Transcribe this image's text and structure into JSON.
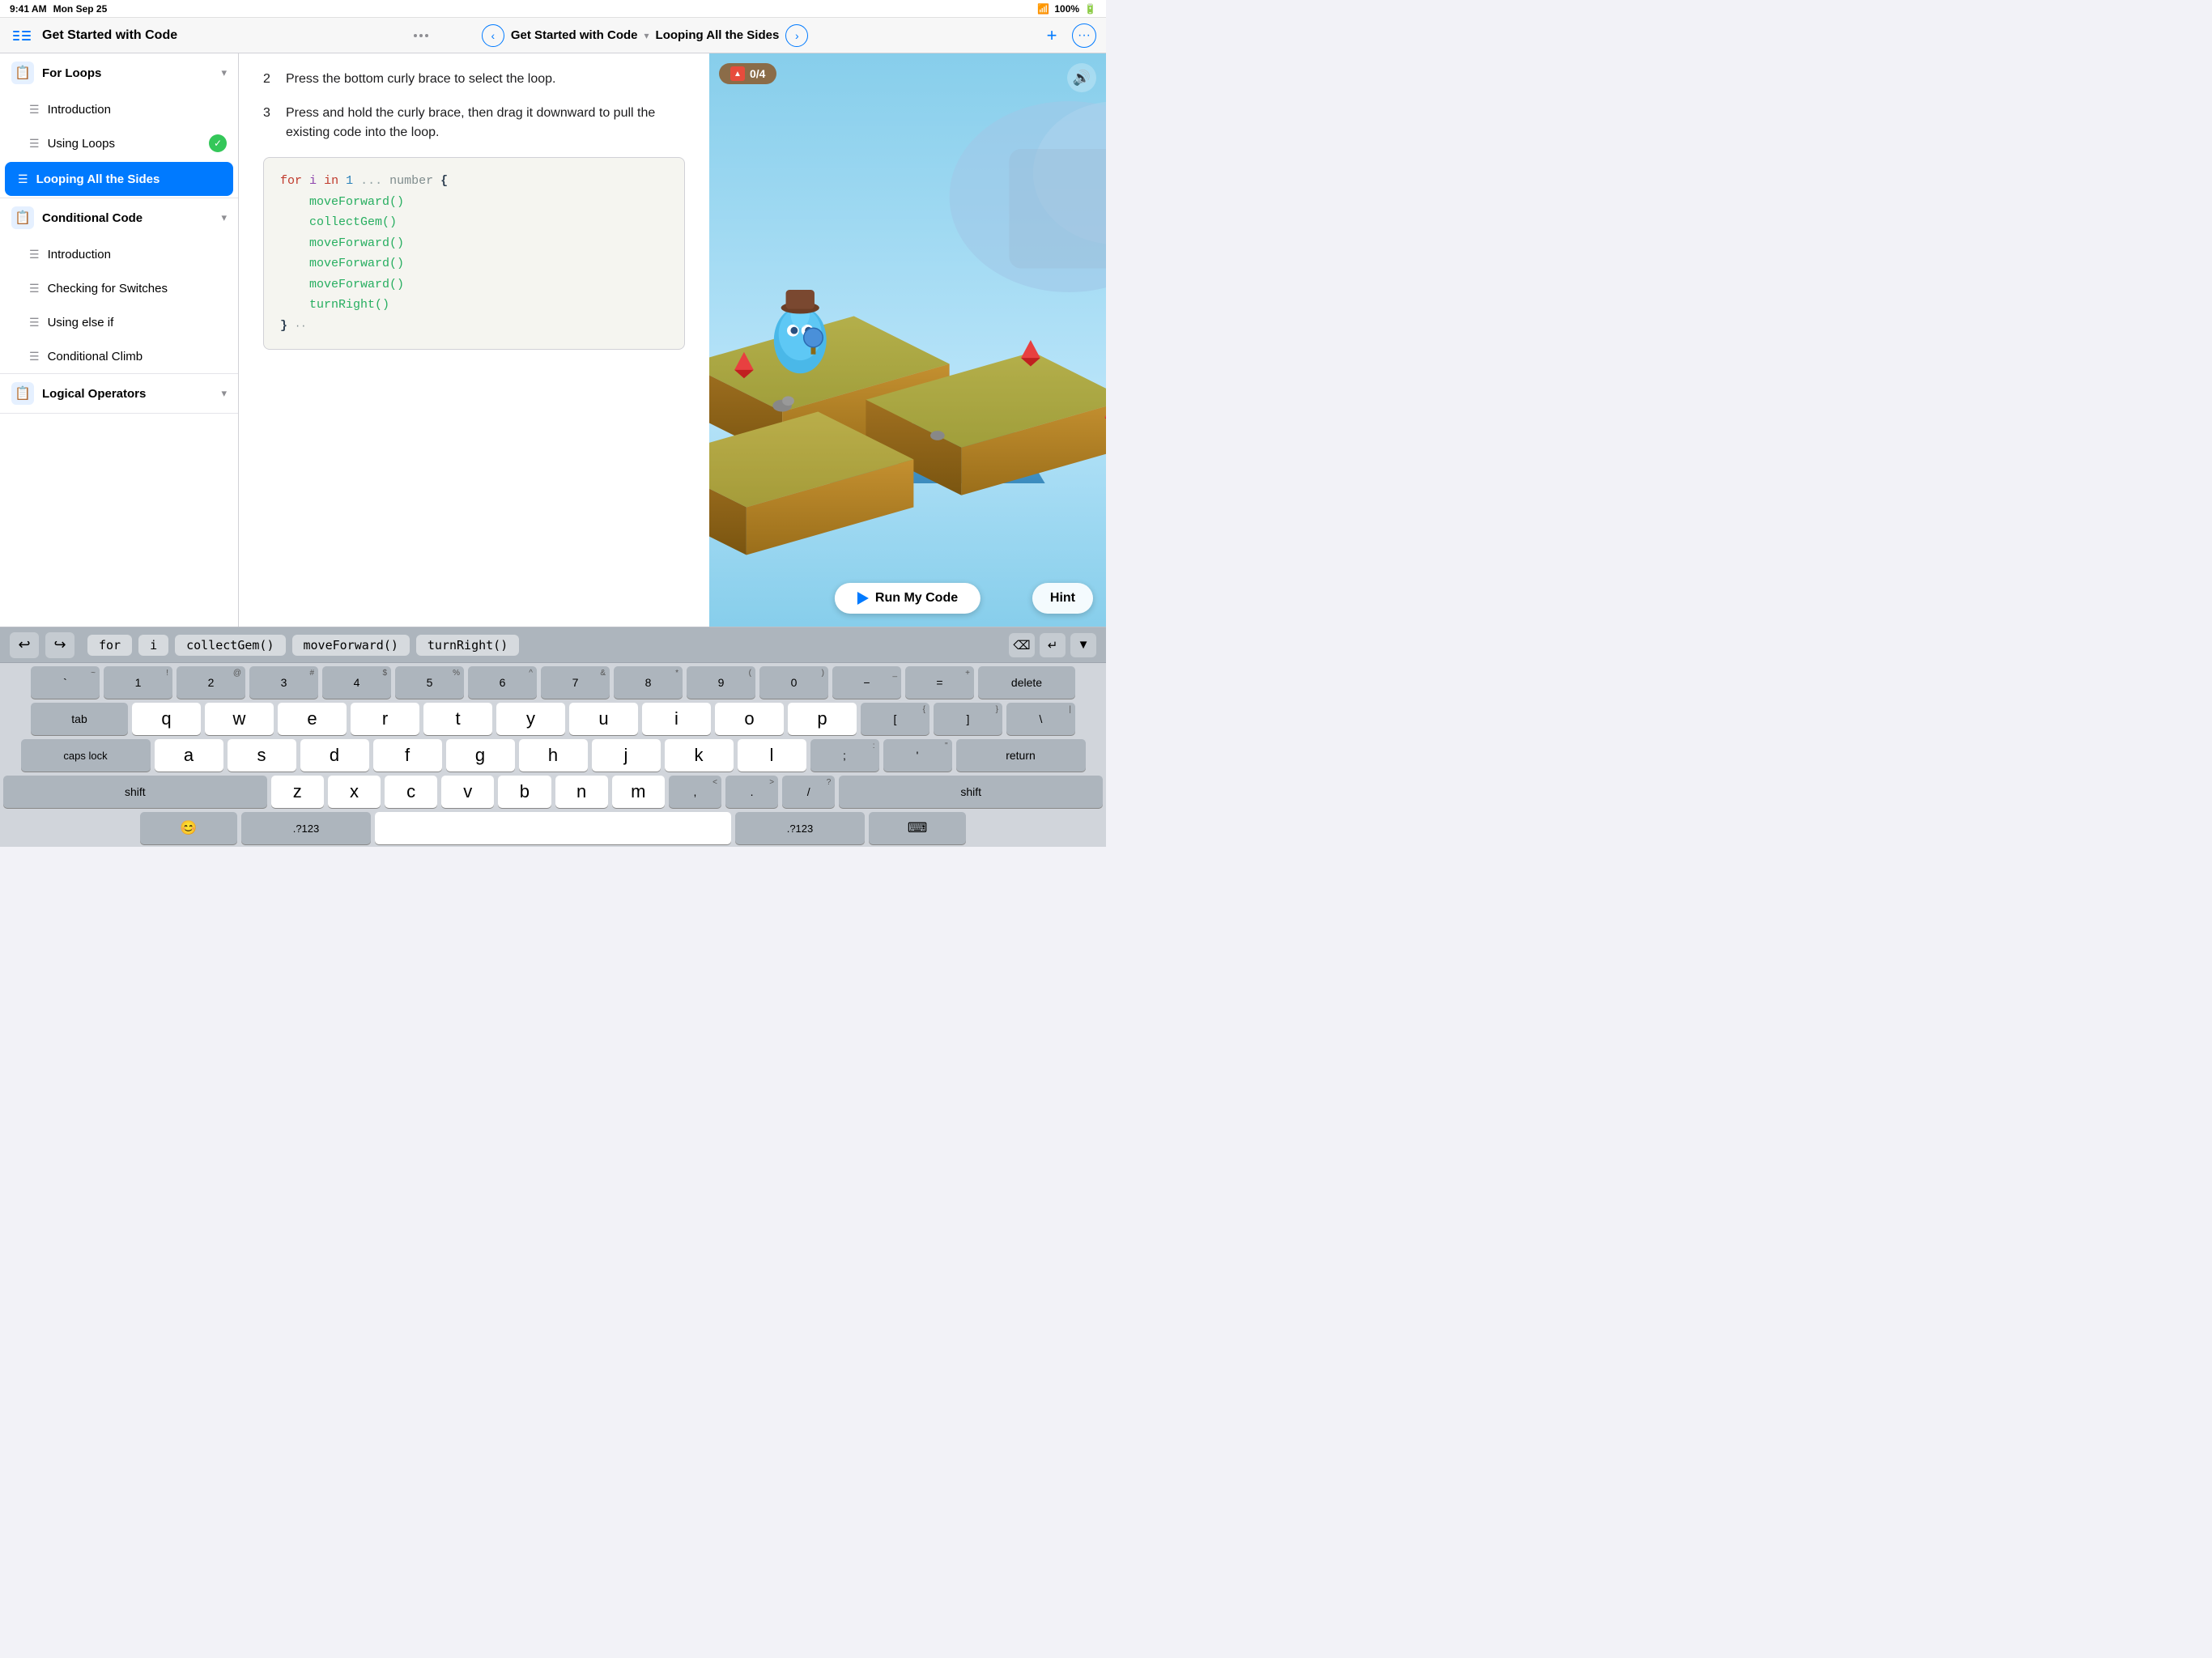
{
  "statusBar": {
    "time": "9:41 AM",
    "date": "Mon Sep 25",
    "wifi": "WiFi",
    "battery": "100%"
  },
  "navBar": {
    "appTitle": "Get Started with Code",
    "breadcrumbTitle": "Get Started with Code",
    "chevron": "▾",
    "lessonTitle": "Looping All the Sides",
    "addBtn": "+",
    "moreBtn": "···"
  },
  "sidebar": {
    "sections": [
      {
        "id": "for-loops",
        "icon": "📋",
        "title": "For Loops",
        "expanded": true,
        "items": [
          {
            "id": "intro-fl",
            "label": "Introduction",
            "active": false,
            "check": false
          },
          {
            "id": "using-loops",
            "label": "Using Loops",
            "active": false,
            "check": true
          },
          {
            "id": "looping-all",
            "label": "Looping All the Sides",
            "active": true,
            "check": false
          }
        ]
      },
      {
        "id": "conditional-code",
        "icon": "📋",
        "title": "Conditional Code",
        "expanded": true,
        "items": [
          {
            "id": "intro-cc",
            "label": "Introduction",
            "active": false,
            "check": false
          },
          {
            "id": "checking-switches",
            "label": "Checking for Switches",
            "active": false,
            "check": false
          },
          {
            "id": "using-else-if",
            "label": "Using else if",
            "active": false,
            "check": false
          },
          {
            "id": "conditional-climb",
            "label": "Conditional Climb",
            "active": false,
            "check": false
          }
        ]
      },
      {
        "id": "logical-operators",
        "icon": "📋",
        "title": "Logical Operators",
        "expanded": false,
        "items": []
      }
    ]
  },
  "content": {
    "steps": [
      {
        "number": "2",
        "text": "Press the bottom curly brace to select the loop."
      },
      {
        "number": "3",
        "text": "Press and hold the curly brace, then drag it downward to pull the existing code into the loop."
      }
    ],
    "code": {
      "line1": "for i in 1 ... number {",
      "line2": "    moveForward()",
      "line3": "    collectGem()",
      "line4": "    moveForward()",
      "line5": "    moveForward()",
      "line6": "    moveForward()",
      "line7": "    turnRight()",
      "line8": "} ··"
    }
  },
  "game": {
    "scoreLabel": "0/4",
    "runButtonLabel": "Run My Code",
    "hintButtonLabel": "Hint"
  },
  "keyboard": {
    "toolbar": {
      "undoLabel": "↩",
      "redoLabel": "↪",
      "suggestions": [
        "for",
        "i",
        "collectGem()",
        "moveForward()",
        "turnRight()"
      ],
      "dismissBtn": "⌫",
      "returnBtn": "↵",
      "collapseBtn": "▼"
    },
    "rows": [
      {
        "keys": [
          {
            "top": "~",
            "bottom": "`",
            "type": "dark"
          },
          {
            "top": "!",
            "bottom": "1",
            "type": "dark"
          },
          {
            "top": "@",
            "bottom": "2",
            "type": "dark"
          },
          {
            "top": "#",
            "bottom": "3",
            "type": "dark"
          },
          {
            "top": "$",
            "bottom": "4",
            "type": "dark"
          },
          {
            "top": "%",
            "bottom": "5",
            "type": "dark"
          },
          {
            "top": "^",
            "bottom": "6",
            "type": "dark"
          },
          {
            "top": "&",
            "bottom": "7",
            "type": "dark"
          },
          {
            "top": "*",
            "bottom": "8",
            "type": "dark"
          },
          {
            "top": "(",
            "bottom": "9",
            "type": "dark"
          },
          {
            "top": ")",
            "bottom": "0",
            "type": "dark"
          },
          {
            "top": "_",
            "bottom": "−",
            "type": "dark"
          },
          {
            "top": "+",
            "bottom": "=",
            "type": "dark"
          },
          {
            "label": "delete",
            "type": "dark",
            "width": "wide"
          }
        ]
      },
      {
        "keys": [
          {
            "label": "tab",
            "type": "dark",
            "width": "wide"
          },
          {
            "label": "q"
          },
          {
            "label": "w"
          },
          {
            "label": "e"
          },
          {
            "label": "r"
          },
          {
            "label": "t"
          },
          {
            "label": "y"
          },
          {
            "label": "u"
          },
          {
            "label": "i"
          },
          {
            "label": "o"
          },
          {
            "label": "p"
          },
          {
            "top": "{",
            "bottom": "[",
            "type": "dark"
          },
          {
            "top": "}",
            "bottom": "]",
            "type": "dark"
          },
          {
            "top": "|",
            "bottom": "\\",
            "type": "dark"
          }
        ]
      },
      {
        "keys": [
          {
            "label": "caps lock",
            "type": "dark",
            "width": "wider"
          },
          {
            "label": "a"
          },
          {
            "label": "s"
          },
          {
            "label": "d"
          },
          {
            "label": "f"
          },
          {
            "label": "g"
          },
          {
            "label": "h"
          },
          {
            "label": "j"
          },
          {
            "label": "k"
          },
          {
            "label": "l"
          },
          {
            "top": ":",
            "bottom": ";",
            "type": "dark"
          },
          {
            "top": "\"",
            "bottom": "'",
            "type": "dark"
          },
          {
            "label": "return",
            "type": "dark",
            "width": "wider"
          }
        ]
      },
      {
        "keys": [
          {
            "label": "shift",
            "type": "dark",
            "width": "widest"
          },
          {
            "label": "z"
          },
          {
            "label": "x"
          },
          {
            "label": "c"
          },
          {
            "label": "v"
          },
          {
            "label": "b"
          },
          {
            "label": "n"
          },
          {
            "label": "m"
          },
          {
            "top": "<",
            "bottom": ",",
            "type": "dark"
          },
          {
            "top": ">",
            "bottom": ".",
            "type": "dark"
          },
          {
            "top": "?",
            "bottom": "/",
            "type": "dark"
          },
          {
            "label": "shift",
            "type": "dark",
            "width": "widest"
          }
        ]
      },
      {
        "keys": [
          {
            "label": "😊",
            "type": "dark",
            "width": "wide"
          },
          {
            "label": ".?123",
            "type": "dark",
            "width": "wider"
          },
          {
            "label": "",
            "type": "normal",
            "width": "widest"
          },
          {
            "label": ".?123",
            "type": "dark",
            "width": "wider"
          },
          {
            "label": "⌨",
            "type": "dark",
            "width": "wide"
          }
        ]
      }
    ]
  }
}
